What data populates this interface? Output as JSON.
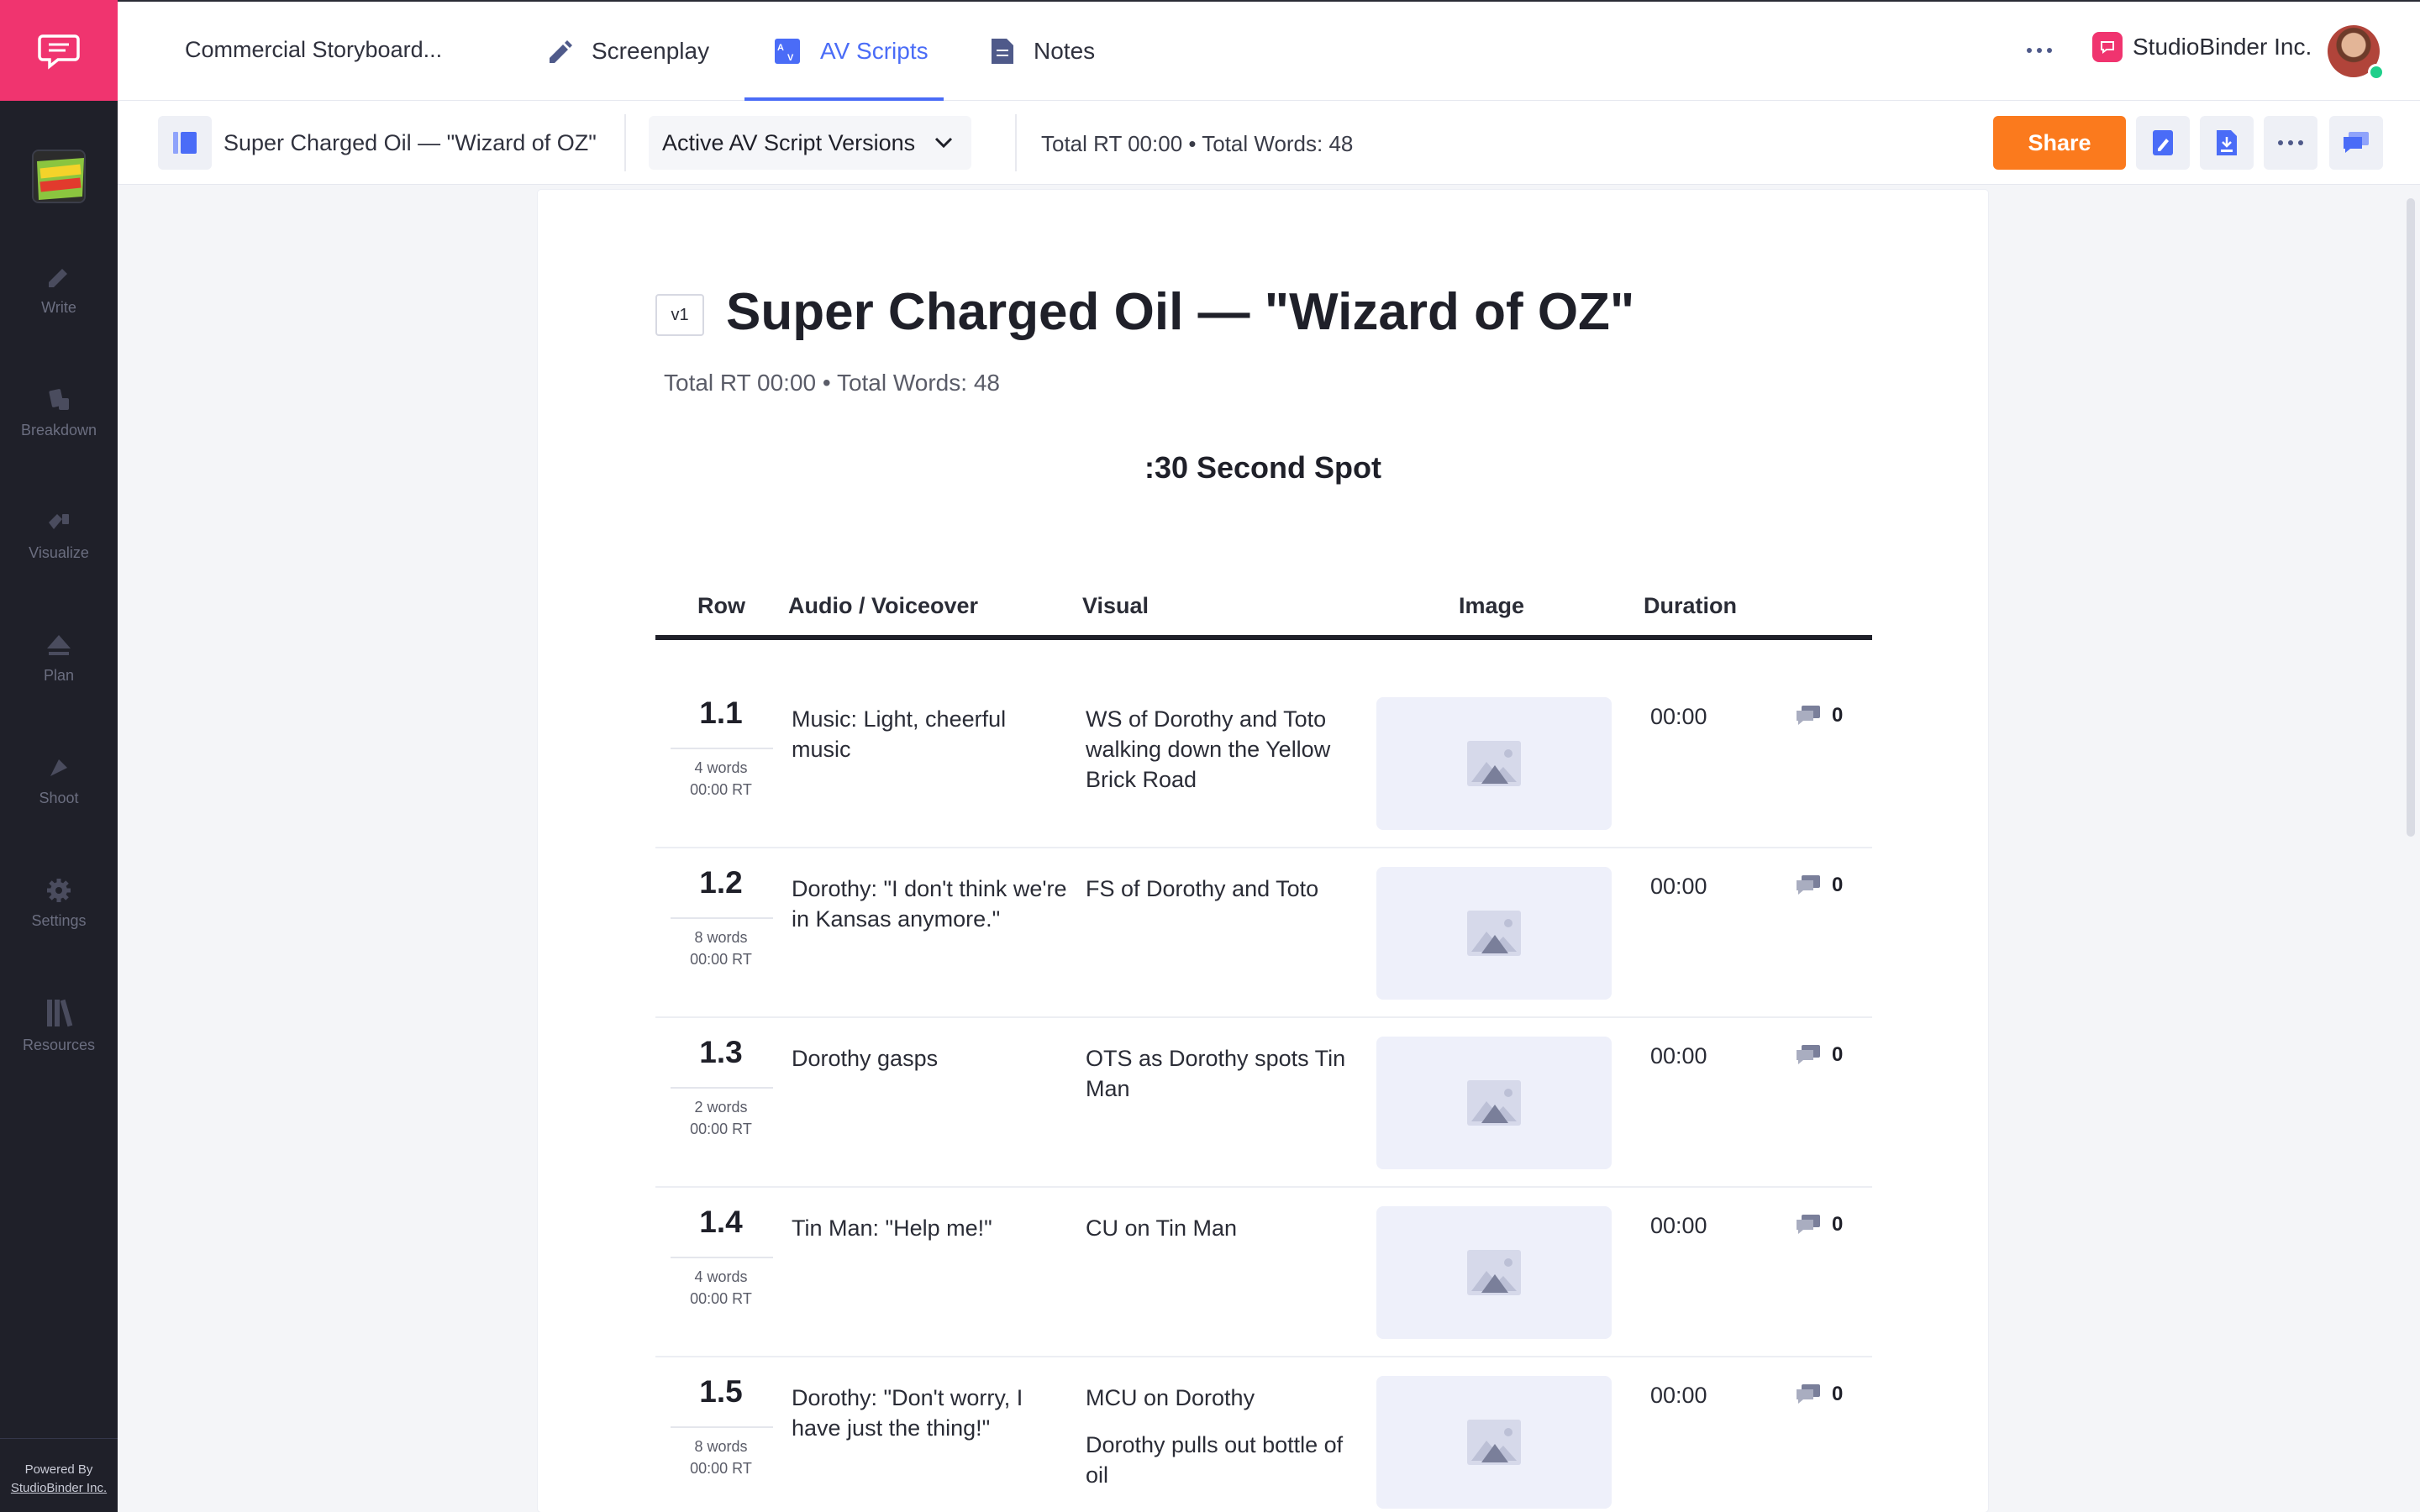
{
  "sidebar": {
    "project_thumb_text": "SUPER CHARGED",
    "items": [
      {
        "label": "Write",
        "icon": "pencil-icon"
      },
      {
        "label": "Breakdown",
        "icon": "breakdown-icon"
      },
      {
        "label": "Visualize",
        "icon": "visualize-icon"
      },
      {
        "label": "Plan",
        "icon": "plan-icon"
      },
      {
        "label": "Shoot",
        "icon": "shoot-icon"
      },
      {
        "label": "Settings",
        "icon": "gear-icon"
      },
      {
        "label": "Resources",
        "icon": "books-icon"
      }
    ],
    "powered_by": "Powered By",
    "powered_link": "StudioBinder Inc."
  },
  "topbar": {
    "project_title": "Commercial Storyboard...",
    "tabs": [
      {
        "label": "Screenplay",
        "icon": "pencil-icon"
      },
      {
        "label": "AV Scripts",
        "icon": "av-icon",
        "active": true
      },
      {
        "label": "Notes",
        "icon": "document-icon"
      }
    ],
    "company": "StudioBinder Inc."
  },
  "subbar": {
    "document_name": "Super Charged Oil — \"Wizard of OZ\"",
    "versions_label": "Active AV Script Versions",
    "totals": "Total RT 00:00 • Total Words: 48",
    "share_label": "Share"
  },
  "document": {
    "version": "v1",
    "title": "Super Charged Oil — \"Wizard of OZ\"",
    "meta": "Total RT 00:00 • Total Words: 48",
    "spot": ":30 Second Spot",
    "columns": {
      "row": "Row",
      "audio": "Audio / Voiceover",
      "visual": "Visual",
      "image": "Image",
      "duration": "Duration"
    },
    "rows": [
      {
        "num": "1.1",
        "words": "4 words",
        "rt": "00:00 RT",
        "audio": "Music: Light, cheerful music",
        "visual": "WS of Dorothy and Toto walking down the Yellow Brick Road",
        "visual2": "",
        "duration": "00:00",
        "comments": "0"
      },
      {
        "num": "1.2",
        "words": "8 words",
        "rt": "00:00 RT",
        "audio": "Dorothy: \"I don't think we're in Kansas anymore.\"",
        "visual": "FS of Dorothy and Toto",
        "visual2": "",
        "duration": "00:00",
        "comments": "0"
      },
      {
        "num": "1.3",
        "words": "2 words",
        "rt": "00:00 RT",
        "audio": "Dorothy gasps",
        "visual": "OTS as Dorothy spots Tin Man",
        "visual2": "",
        "duration": "00:00",
        "comments": "0"
      },
      {
        "num": "1.4",
        "words": "4 words",
        "rt": "00:00 RT",
        "audio": "Tin Man: \"Help me!\"",
        "visual": "CU on Tin Man",
        "visual2": "",
        "duration": "00:00",
        "comments": "0"
      },
      {
        "num": "1.5",
        "words": "8 words",
        "rt": "00:00 RT",
        "audio": "Dorothy: \"Don't worry, I have just the thing!\"",
        "visual": "MCU on Dorothy",
        "visual2": "Dorothy pulls out bottle of oil",
        "duration": "00:00",
        "comments": "0"
      }
    ]
  },
  "colors": {
    "brand": "#f0346f",
    "accent": "#4a6cf7",
    "share": "#fb7a1d",
    "sidebar": "#1f2029"
  }
}
